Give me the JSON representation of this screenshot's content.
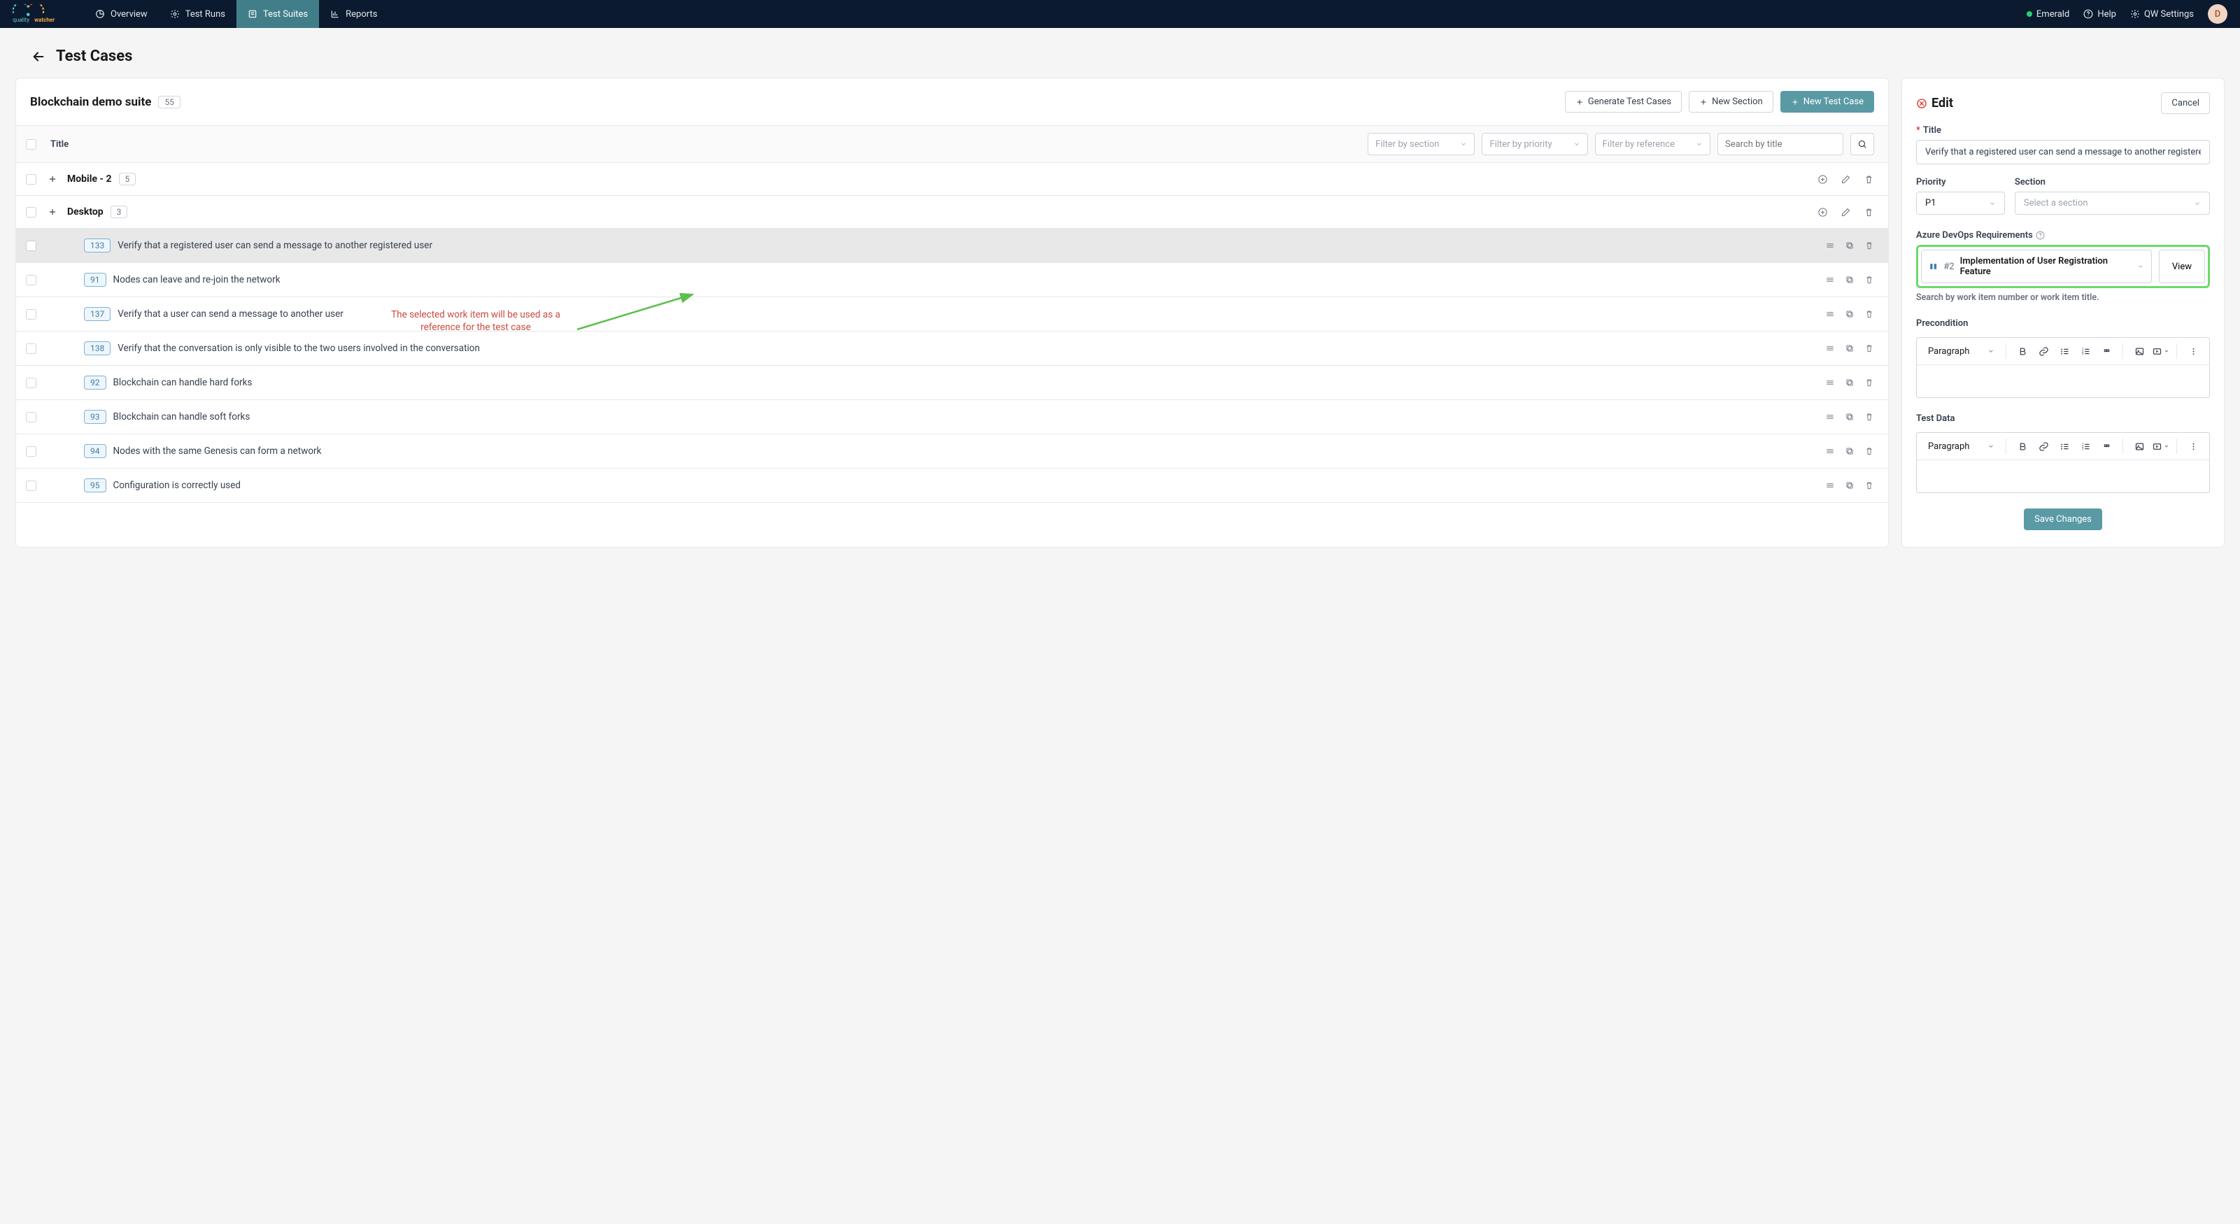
{
  "nav": {
    "brand": "qualitywatcher",
    "items": [
      {
        "label": "Overview"
      },
      {
        "label": "Test Runs"
      },
      {
        "label": "Test Suites"
      },
      {
        "label": "Reports"
      }
    ],
    "workspace": "Emerald",
    "help": "Help",
    "settings": "QW Settings",
    "avatar": "D"
  },
  "page": {
    "title": "Test Cases"
  },
  "suite": {
    "name": "Blockchain demo suite",
    "count": "55",
    "generate": "Generate Test Cases",
    "newSection": "New Section",
    "newCase": "New Test Case"
  },
  "filters": {
    "titleCol": "Title",
    "section": "Filter by section",
    "priority": "Filter by priority",
    "reference": "Filter by reference",
    "searchPlaceholder": "Search by title"
  },
  "sections": [
    {
      "name": "Mobile - 2",
      "count": "5"
    },
    {
      "name": "Desktop",
      "count": "3"
    }
  ],
  "rows": [
    {
      "id": "133",
      "title": "Verify that a registered user can send a message to another registered user",
      "selected": true
    },
    {
      "id": "91",
      "title": "Nodes can leave and re-join the network"
    },
    {
      "id": "137",
      "title": "Verify that a user can send a message to another user"
    },
    {
      "id": "138",
      "title": "Verify that the conversation is only visible to the two users involved in the conversation"
    },
    {
      "id": "92",
      "title": "Blockchain can handle hard forks"
    },
    {
      "id": "93",
      "title": "Blockchain can handle soft forks"
    },
    {
      "id": "94",
      "title": "Nodes with the same Genesis can form a network"
    },
    {
      "id": "95",
      "title": "Configuration is correctly used"
    }
  ],
  "edit": {
    "heading": "Edit",
    "cancel": "Cancel",
    "titleLabel": "Title",
    "titleValue": "Verify that a registered user can send a message to another registered u",
    "priorityLabel": "Priority",
    "priorityValue": "P1",
    "sectionLabel": "Section",
    "sectionPlaceholder": "Select a section",
    "azureLabel": "Azure DevOps Requirements",
    "azure": {
      "num": "#2",
      "title": "Implementation of User Registration Feature",
      "view": "View"
    },
    "azureHint": "Search by work item number or work item title.",
    "preconditionLabel": "Precondition",
    "testDataLabel": "Test Data",
    "paragraph": "Paragraph",
    "save": "Save Changes"
  },
  "annotation": "The selected work item will be used as a reference for the test case"
}
